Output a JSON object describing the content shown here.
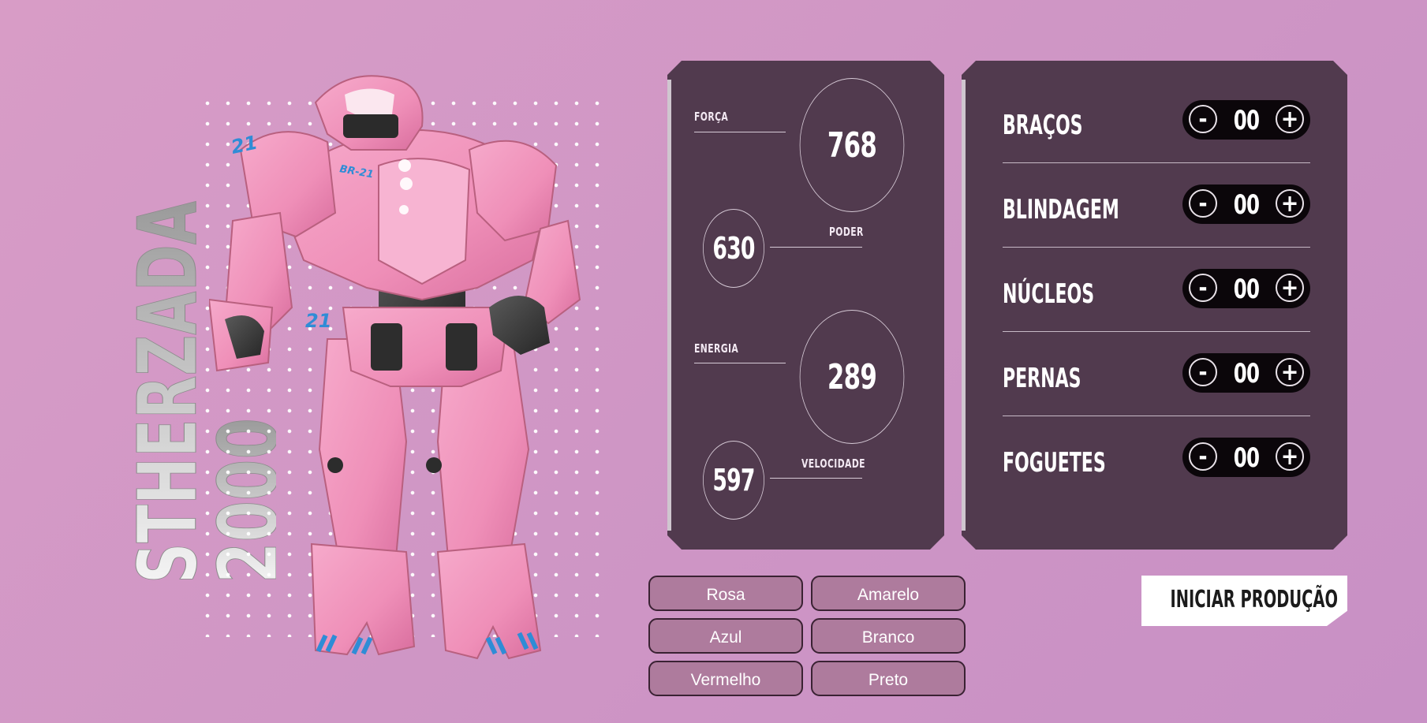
{
  "robot": {
    "name_line1": "STHERZADA",
    "name_line2": "2000",
    "badge_chest": "BR-21",
    "badge_shoulder": "21",
    "badge_leg": "21"
  },
  "stats": [
    {
      "label": "FORÇA",
      "value": "768"
    },
    {
      "label": "PODER",
      "value": "630"
    },
    {
      "label": "ENERGIA",
      "value": "289"
    },
    {
      "label": "VELOCIDADE",
      "value": "597"
    }
  ],
  "parts": [
    {
      "label": "BRAÇOS",
      "value": "00"
    },
    {
      "label": "BLINDAGEM",
      "value": "00"
    },
    {
      "label": "NÚCLEOS",
      "value": "00"
    },
    {
      "label": "PERNAS",
      "value": "00"
    },
    {
      "label": "FOGUETES",
      "value": "00"
    }
  ],
  "counter": {
    "minus": "-",
    "plus": "+"
  },
  "colors": [
    "Rosa",
    "Amarelo",
    "Azul",
    "Branco",
    "Vermelho",
    "Preto"
  ],
  "start_button": "INICIAR PRODUÇÃO",
  "theme": {
    "background": "#d89cc6",
    "panel": "#513a4e",
    "button": "#ae7b9d",
    "accent": "#2f8cd6"
  }
}
